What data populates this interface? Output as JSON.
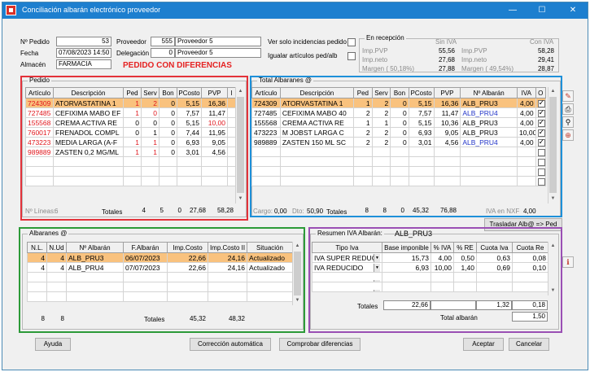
{
  "window": {
    "title": "Conciliación albarán electrónico proveedor",
    "minimize": "—",
    "maximize": "☐",
    "close": "✕"
  },
  "header": {
    "pedido_label": "Nº Pedido",
    "pedido_value": "53",
    "fecha_label": "Fecha",
    "fecha_value": "07/08/2023 14:50",
    "almacen_label": "Almacén",
    "almacen_value": "FARMACIA",
    "proveedor_label": "Proveedor",
    "proveedor_code": "555",
    "proveedor_name": "Proveedor 5",
    "delegacion_label": "Delegación",
    "delegacion_code": "0",
    "delegacion_name": "Proveedor 5",
    "solo_incidencias_label": "Ver solo incidencias pedido",
    "igualar_label": "Igualar artículos ped/alb",
    "alert": "PEDIDO CON DIFERENCIAS"
  },
  "recepcion": {
    "title": "En recepción",
    "sin_iva": "Sin IVA",
    "con_iva": "Con IVA",
    "left": [
      {
        "label": "Imp.PVP",
        "value": "55,56"
      },
      {
        "label": "Imp.neto",
        "value": "27,68"
      },
      {
        "label": "Margen ( 50,18%)",
        "value": "27,88"
      }
    ],
    "right": [
      {
        "label": "Imp.PVP",
        "value": "58,28"
      },
      {
        "label": "Imp.neto",
        "value": "29,41"
      },
      {
        "label": "Margen ( 49,54%)",
        "value": "28,87"
      }
    ]
  },
  "pedido": {
    "caption": "Pedido",
    "columns": [
      "Artículo",
      "Descripción",
      "Ped",
      "Serv",
      "Bon",
      "PCosto",
      "PVP",
      "I"
    ],
    "rows": [
      {
        "art": "724309",
        "desc": "ATORVASTATINA 1",
        "ped": "1",
        "serv": "2",
        "bon": "0",
        "pcosto": "5,15",
        "pvp": "16,36",
        "sel": true
      },
      {
        "art": "727485",
        "desc": "CEFIXIMA MABO EF",
        "ped": "1",
        "serv": "0",
        "bon": "0",
        "pcosto": "7,57",
        "pvp": "11,47"
      },
      {
        "art": "155568",
        "desc": "CREMA ACTIVA RE",
        "ped": "0",
        "serv": "0",
        "bon": "0",
        "pcosto": "5,15",
        "pvp": "10,00"
      },
      {
        "art": "760017",
        "desc": "FRENADOL COMPL",
        "ped": "0",
        "serv": "1",
        "bon": "0",
        "pcosto": "7,44",
        "pvp": "11,95"
      },
      {
        "art": "473223",
        "desc": "MEDIA LARGA (A-F",
        "ped": "1",
        "serv": "1",
        "bon": "0",
        "pcosto": "6,93",
        "pvp": "9,05"
      },
      {
        "art": "989889",
        "desc": "ZASTEN 0,2 MG/ML",
        "ped": "1",
        "serv": "1",
        "bon": "0",
        "pcosto": "3,01",
        "pvp": "4,56"
      }
    ],
    "lineas_label": "Nº Líneas:",
    "lineas_value": "6",
    "totales_label": "Totales",
    "totals": {
      "ped": "4",
      "serv": "5",
      "bon": "0",
      "pcosto": "27,68",
      "pvp": "58,28"
    }
  },
  "total_albaranes": {
    "caption": "Total Albaranes @",
    "columns": [
      "Artículo",
      "Descripción",
      "Ped",
      "Serv",
      "Bon",
      "PCosto",
      "PVP",
      "Nº Albarán",
      "IVA",
      "O"
    ],
    "rows": [
      {
        "art": "724309",
        "desc": "ATORVASTATINA 1",
        "ped": "1",
        "serv": "2",
        "bon": "0",
        "pcosto": "5,15",
        "pvp": "16,36",
        "alb": "ALB_PRU3",
        "iva": "4,00",
        "sel": true
      },
      {
        "art": "727485",
        "desc": "CEFIXIMA MABO 40",
        "ped": "2",
        "serv": "2",
        "bon": "0",
        "pcosto": "7,57",
        "pvp": "11,47",
        "alb": "ALB_PRU4",
        "iva": "4,00"
      },
      {
        "art": "155568",
        "desc": "CREMA ACTIVA RE",
        "ped": "1",
        "serv": "1",
        "bon": "0",
        "pcosto": "5,15",
        "pvp": "10,36",
        "alb": "ALB_PRU3",
        "iva": "4,00"
      },
      {
        "art": "473223",
        "desc": "M JOBST LARGA C",
        "ped": "2",
        "serv": "2",
        "bon": "0",
        "pcosto": "6,93",
        "pvp": "9,05",
        "alb": "ALB_PRU3",
        "iva": "10,00"
      },
      {
        "art": "989889",
        "desc": "ZASTEN 150 ML SC",
        "ped": "2",
        "serv": "2",
        "bon": "0",
        "pcosto": "3,01",
        "pvp": "4,56",
        "alb": "ALB_PRU4",
        "iva": "4,00"
      }
    ],
    "cargo_label": "Cargo:",
    "cargo_value": "0,00",
    "dto_label": "Dto:",
    "dto_value": "50,90",
    "totales_label": "Totales",
    "totals": {
      "ped": "8",
      "serv": "8",
      "bon": "0",
      "pcosto": "45,32",
      "pvp": "76,88"
    },
    "iva_nxf_label": "IVA en NXF",
    "iva_nxf_value": "4,00"
  },
  "trasladar_button": "Trasladar Alb@ => Ped",
  "albaranes": {
    "caption": "Albaranes @",
    "columns": [
      "N.L.",
      "N.Ud",
      "Nº Albarán",
      "F.Albarán",
      "Imp.Costo",
      "Imp.Costo II",
      "Situación"
    ],
    "rows": [
      {
        "nl": "4",
        "nud": "4",
        "alb": "ALB_PRU3",
        "fecha": "06/07/2023",
        "costo": "22,66",
        "costo2": "24,16",
        "sit": "Actualizado",
        "sel": true
      },
      {
        "nl": "4",
        "nud": "4",
        "alb": "ALB_PRU4",
        "fecha": "07/07/2023",
        "costo": "22,66",
        "costo2": "24,16",
        "sit": "Actualizado"
      }
    ],
    "footer": {
      "nl": "8",
      "nud": "8",
      "totales": "Totales",
      "costo": "45,32",
      "costo2": "48,32"
    }
  },
  "resumen_iva": {
    "caption": "Resumen IVA Albarán:",
    "albaran": "ALB_PRU3",
    "columns": [
      "Tipo Iva",
      "Base imponible",
      "% IVA",
      "% RE",
      "Cuota Iva",
      "Cuota Re"
    ],
    "rows": [
      {
        "tipo": "IVA SUPER REDUC",
        "base": "15,73",
        "iva": "4,00",
        "re": "0,50",
        "cuota": "0,63",
        "cuotare": "0,08"
      },
      {
        "tipo": "IVA REDUCIDO",
        "base": "6,93",
        "iva": "10,00",
        "re": "1,40",
        "cuota": "0,69",
        "cuotare": "0,10"
      },
      {
        "tipo": "",
        "base": "",
        "iva": "",
        "re": "",
        "cuota": "",
        "cuotare": ""
      },
      {
        "tipo": "",
        "base": "",
        "iva": "",
        "re": "",
        "cuota": "",
        "cuotare": ""
      }
    ],
    "totales_label": "Totales",
    "total_base": "22,66",
    "total_cuota": "1,32",
    "total_re": "0,18",
    "total_albaran_label": "Total albarán",
    "total_albaran_value": "1,50"
  },
  "buttons": {
    "ayuda": "Ayuda",
    "correccion": "Corrección automática",
    "comprobar": "Comprobar diferencias",
    "aceptar": "Aceptar",
    "cancelar": "Cancelar"
  }
}
